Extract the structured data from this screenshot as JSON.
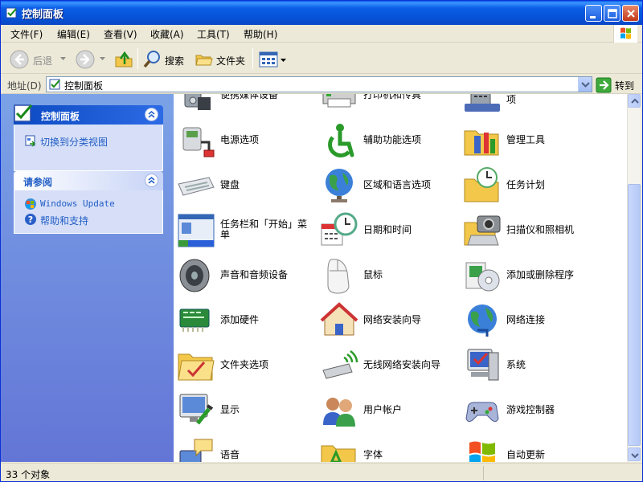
{
  "window": {
    "title": "控制面板"
  },
  "menu": [
    "文件(F)",
    "编辑(E)",
    "查看(V)",
    "收藏(A)",
    "工具(T)",
    "帮助(H)"
  ],
  "toolbar": {
    "back": "后退",
    "search": "搜索",
    "folders": "文件夹"
  },
  "address": {
    "label": "地址(D)",
    "value": "控制面板",
    "go": "转到"
  },
  "left": {
    "panel1": {
      "title": "控制面板",
      "link": "切换到分类视图"
    },
    "panel2": {
      "title": "请参阅",
      "links": [
        "Windows Update",
        "帮助和支持"
      ]
    }
  },
  "items": [
    {
      "label": "便携媒体设备",
      "icon": "portable-media-icon"
    },
    {
      "label": "打印机和传真",
      "icon": "printer-fax-icon"
    },
    {
      "label": "电话和调制解调器选项",
      "icon": "phone-modem-icon"
    },
    {
      "label": "电源选项",
      "icon": "power-options-icon"
    },
    {
      "label": "辅助功能选项",
      "icon": "accessibility-icon"
    },
    {
      "label": "管理工具",
      "icon": "admin-tools-icon"
    },
    {
      "label": "键盘",
      "icon": "keyboard-icon"
    },
    {
      "label": "区域和语言选项",
      "icon": "globe-icon"
    },
    {
      "label": "任务计划",
      "icon": "scheduled-tasks-icon"
    },
    {
      "label": "任务栏和「开始」菜单",
      "icon": "taskbar-icon"
    },
    {
      "label": "日期和时间",
      "icon": "date-time-icon"
    },
    {
      "label": "扫描仪和照相机",
      "icon": "scanner-camera-icon"
    },
    {
      "label": "声音和音频设备",
      "icon": "speaker-icon"
    },
    {
      "label": "鼠标",
      "icon": "mouse-icon"
    },
    {
      "label": "添加或删除程序",
      "icon": "add-remove-programs-icon"
    },
    {
      "label": "添加硬件",
      "icon": "add-hardware-icon"
    },
    {
      "label": "网络安装向导",
      "icon": "network-setup-icon"
    },
    {
      "label": "网络连接",
      "icon": "network-connections-icon"
    },
    {
      "label": "文件夹选项",
      "icon": "folder-options-icon"
    },
    {
      "label": "无线网络安装向导",
      "icon": "wireless-setup-icon"
    },
    {
      "label": "系统",
      "icon": "system-icon"
    },
    {
      "label": "显示",
      "icon": "display-icon"
    },
    {
      "label": "用户帐户",
      "icon": "user-accounts-icon"
    },
    {
      "label": "游戏控制器",
      "icon": "game-controller-icon"
    },
    {
      "label": "语音",
      "icon": "speech-icon"
    },
    {
      "label": "字体",
      "icon": "fonts-icon"
    },
    {
      "label": "自动更新",
      "icon": "windows-flag-icon"
    }
  ],
  "status": {
    "text": "33 个对象"
  }
}
